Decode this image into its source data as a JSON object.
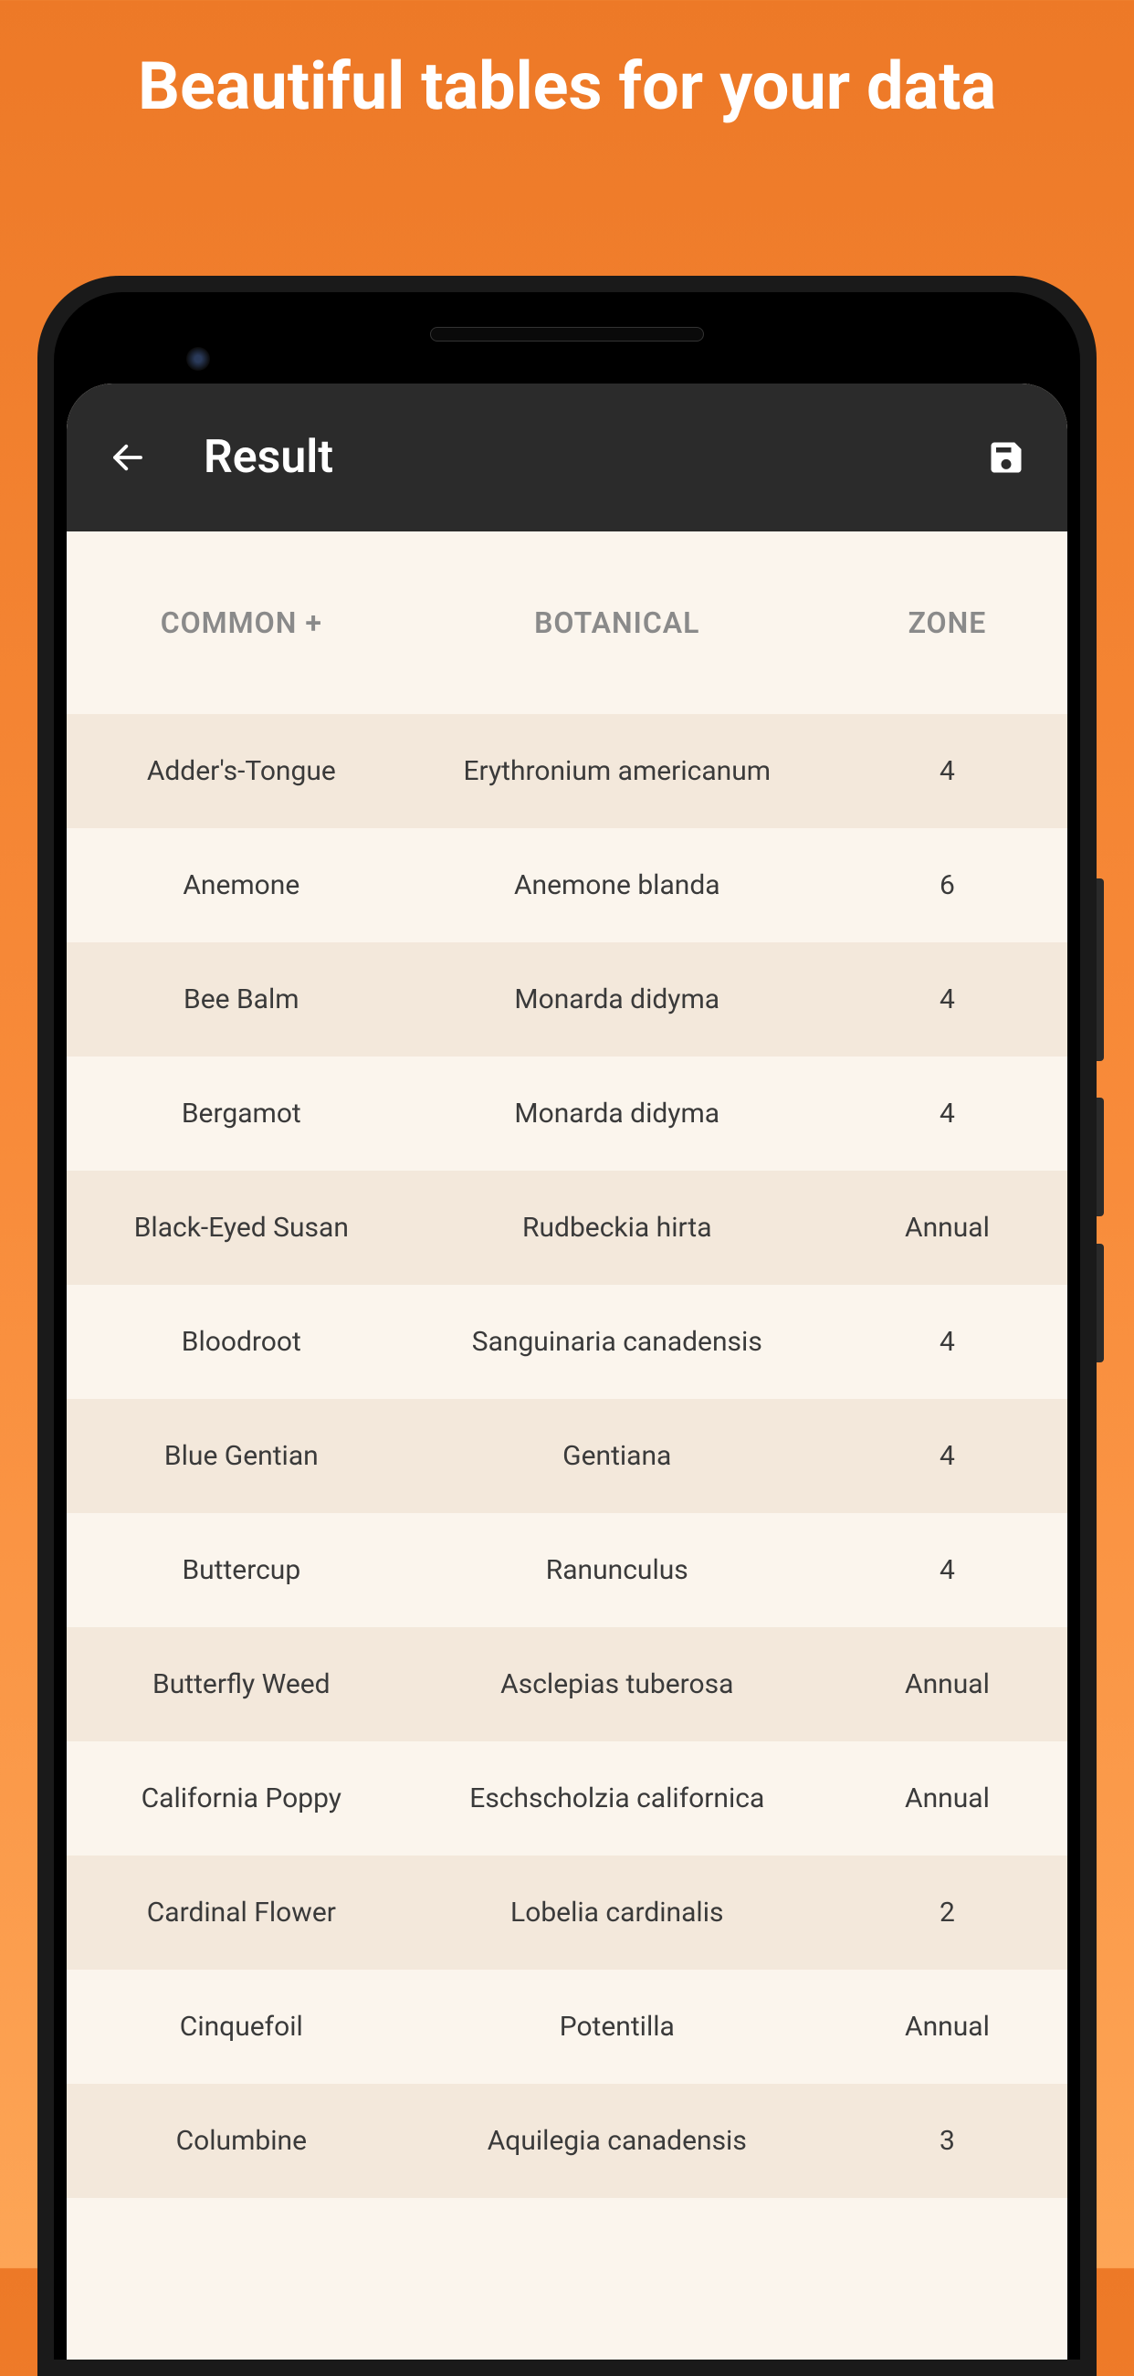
{
  "promo": {
    "title": "Beautiful tables for your data"
  },
  "app_bar": {
    "title": "Result"
  },
  "table": {
    "headers": {
      "common": "COMMON +",
      "botanical": "BOTANICAL",
      "zone": "ZONE"
    },
    "rows": [
      {
        "common": "Adder's-Tongue",
        "botanical": "Erythronium americanum",
        "zone": "4"
      },
      {
        "common": "Anemone",
        "botanical": "Anemone blanda",
        "zone": "6"
      },
      {
        "common": "Bee Balm",
        "botanical": "Monarda didyma",
        "zone": "4"
      },
      {
        "common": "Bergamot",
        "botanical": "Monarda didyma",
        "zone": "4"
      },
      {
        "common": "Black-Eyed Susan",
        "botanical": "Rudbeckia hirta",
        "zone": "Annual"
      },
      {
        "common": "Bloodroot",
        "botanical": "Sanguinaria canadensis",
        "zone": "4"
      },
      {
        "common": "Blue Gentian",
        "botanical": "Gentiana",
        "zone": "4"
      },
      {
        "common": "Buttercup",
        "botanical": "Ranunculus",
        "zone": "4"
      },
      {
        "common": "Butterfly Weed",
        "botanical": "Asclepias tuberosa",
        "zone": "Annual"
      },
      {
        "common": "California Poppy",
        "botanical": "Eschscholzia californica",
        "zone": "Annual"
      },
      {
        "common": "Cardinal Flower",
        "botanical": "Lobelia cardinalis",
        "zone": "2"
      },
      {
        "common": "Cinquefoil",
        "botanical": "Potentilla",
        "zone": "Annual"
      },
      {
        "common": "Columbine",
        "botanical": "Aquilegia canadensis",
        "zone": "3"
      }
    ]
  }
}
